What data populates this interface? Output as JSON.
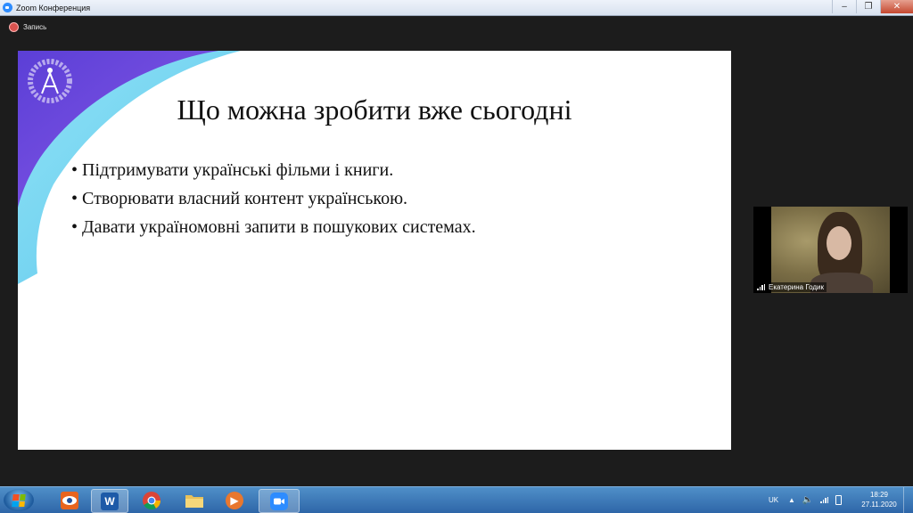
{
  "window": {
    "title": "Zoom Конференция",
    "controls": {
      "minimize": "–",
      "restore": "❐",
      "close": "✕"
    }
  },
  "recording": {
    "label": "Запись",
    "color": "#d9534f"
  },
  "slide": {
    "title": "Що можна зробити вже сьогодні",
    "bullets": [
      "Підтримувати українські фільми і книги.",
      "Створювати власний контент українською.",
      "Давати україномовні запити в пошукових системах."
    ],
    "accent_colors": [
      "#5b3fd6",
      "#6fd0f0"
    ]
  },
  "participant": {
    "name": "Екатерина Годик",
    "icon": "signal-bars-icon"
  },
  "taskbar": {
    "apps": [
      {
        "name": "start-button",
        "icon": "windows-logo-icon"
      },
      {
        "name": "taskbar-app-eye",
        "icon": "eye-icon"
      },
      {
        "name": "taskbar-app-word",
        "icon": "word-icon",
        "glyph": "W"
      },
      {
        "name": "taskbar-app-chrome",
        "icon": "chrome-icon"
      },
      {
        "name": "taskbar-app-explorer",
        "icon": "folder-icon"
      },
      {
        "name": "taskbar-app-media",
        "icon": "media-player-icon",
        "glyph": "▶"
      },
      {
        "name": "taskbar-app-zoom",
        "icon": "zoom-icon"
      }
    ],
    "language": "UK",
    "clock": {
      "time": "18:29",
      "date": "27.11.2020"
    }
  }
}
